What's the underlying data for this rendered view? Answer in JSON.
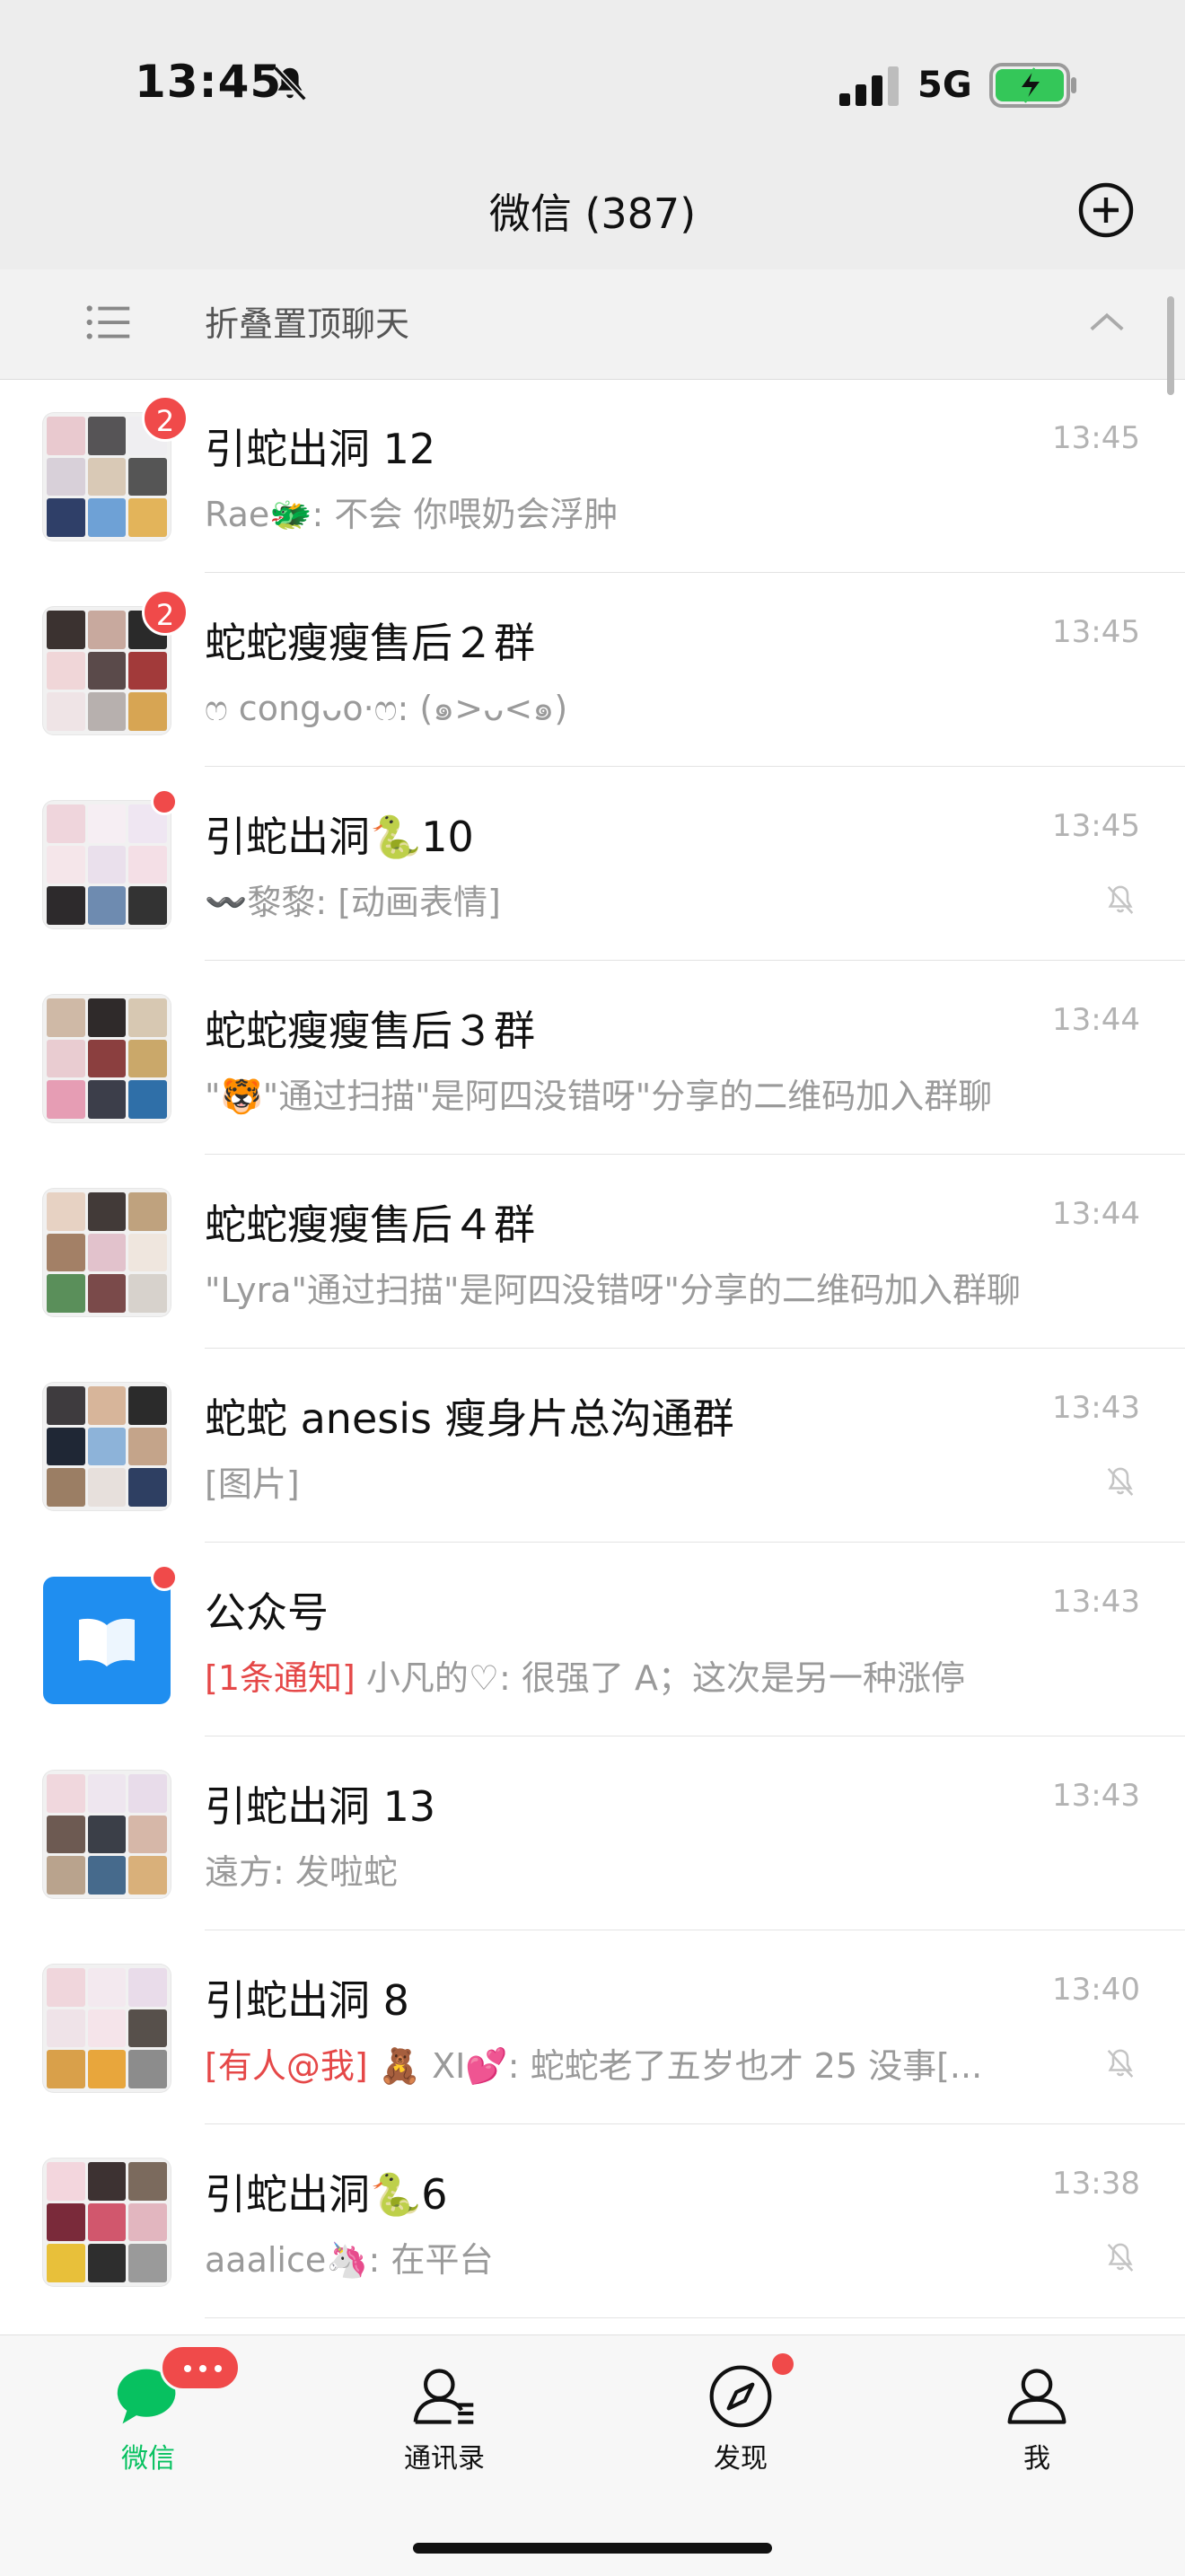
{
  "status_bar": {
    "time": "13:45",
    "network": "5G"
  },
  "header": {
    "title": "微信 (387)"
  },
  "folded_bar": {
    "label": "折叠置顶聊天"
  },
  "chats": [
    {
      "name": "引蛇出洞 12",
      "preview": "Rae🐲: 不会 你喂奶会浮肿",
      "time": "13:45",
      "badge": "2",
      "dot": false,
      "muted": false,
      "tag": "",
      "colors": [
        "#e9c9cf",
        "#565456",
        "#efeef1",
        "#d8d0d9",
        "#d9c9b6",
        "#555",
        "#2f3f68",
        "#6ea1d6",
        "#e3b45a"
      ]
    },
    {
      "name": "蛇蛇瘦瘦售后２群",
      "preview": "ෆ congᴗo·ෆ: (๑>ᴗ<๑)",
      "time": "13:45",
      "badge": "2",
      "dot": false,
      "muted": false,
      "tag": "",
      "colors": [
        "#3b3230",
        "#c8a99e",
        "#2a2a2a",
        "#f0d6d8",
        "#5a4a4a",
        "#a23a3a",
        "#efe4e6",
        "#b7b0ae",
        "#d7a553"
      ]
    },
    {
      "name": "引蛇出洞🐍10",
      "preview": "〰️黎黎: [动画表情]",
      "time": "13:45",
      "badge": "",
      "dot": true,
      "muted": true,
      "tag": "",
      "colors": [
        "#efd5dc",
        "#f6eef3",
        "#efe6f2",
        "#f5e6ea",
        "#eae0ec",
        "#f4dfe6",
        "#2d2a2c",
        "#6e8bb0",
        "#333"
      ]
    },
    {
      "name": "蛇蛇瘦瘦售后３群",
      "preview": "\"🐯\"通过扫描\"是阿四没错呀\"分享的二维码加入群聊",
      "time": "13:44",
      "badge": "",
      "dot": false,
      "muted": false,
      "tag": "",
      "colors": [
        "#cfb9a6",
        "#2f2a2a",
        "#d7c8b2",
        "#e9ccd1",
        "#8b3f3f",
        "#caa86a",
        "#e69db4",
        "#3c3e4a",
        "#2f6fa8"
      ]
    },
    {
      "name": "蛇蛇瘦瘦售后４群",
      "preview": "\"Lyra\"通过扫描\"是阿四没错呀\"分享的二维码加入群聊",
      "time": "13:44",
      "badge": "",
      "dot": false,
      "muted": false,
      "tag": "",
      "colors": [
        "#e7d2c3",
        "#423a38",
        "#bfa27e",
        "#a38066",
        "#e2c2cc",
        "#efe6de",
        "#5a8f5a",
        "#7a4a4a",
        "#d7d2cc"
      ]
    },
    {
      "name": "蛇蛇 anesis 瘦身片总沟通群",
      "preview": "[图片]",
      "time": "13:43",
      "badge": "",
      "dot": false,
      "muted": true,
      "tag": "",
      "colors": [
        "#3e3b3e",
        "#d7b59a",
        "#2b2b2b",
        "#1f2735",
        "#8db3d9",
        "#c4a48a",
        "#9b7e64",
        "#e7e0dc",
        "#2e3f62"
      ]
    },
    {
      "name": "公众号",
      "preview": "小凡的♡: 很强了 A；这次是另一种涨停",
      "time": "13:43",
      "badge": "",
      "dot": true,
      "muted": false,
      "tag": "[1条通知]",
      "official": true,
      "colors": []
    },
    {
      "name": "引蛇出洞 13",
      "preview": "遠方: 发啦蛇",
      "time": "13:43",
      "badge": "",
      "dot": false,
      "muted": false,
      "tag": "",
      "colors": [
        "#f0d7dd",
        "#eee6ef",
        "#e8dcea",
        "#6d5a52",
        "#3b3f48",
        "#d6b7a8",
        "#b9a38d",
        "#466a8c",
        "#d9b07a"
      ]
    },
    {
      "name": "引蛇出洞 8",
      "preview": "🧸 XI💕: 蛇蛇老了五岁也才 25 没事[...",
      "time": "13:40",
      "badge": "",
      "dot": false,
      "muted": true,
      "tag": "[有人@我]",
      "colors": [
        "#f0d6dc",
        "#f3e9ef",
        "#e9dcea",
        "#efe3e8",
        "#f5e4ea",
        "#57504b",
        "#d9a04a",
        "#e8a63c",
        "#8c8c8c"
      ]
    },
    {
      "name": "引蛇出洞🐍6",
      "preview": "aaalice🦄: 在平台",
      "time": "13:38",
      "badge": "",
      "dot": false,
      "muted": true,
      "tag": "",
      "colors": [
        "#f3d6dd",
        "#3d3232",
        "#7b6a5d",
        "#7a2a3a",
        "#d1576d",
        "#e2b6bf",
        "#e8c03a",
        "#2e2e2e",
        "#9a9a9a"
      ]
    }
  ],
  "tabs": [
    {
      "label": "微信",
      "icon": "chat-bubble-icon",
      "active": true
    },
    {
      "label": "通讯录",
      "icon": "contacts-icon",
      "active": false
    },
    {
      "label": "发现",
      "icon": "compass-icon",
      "active": false
    },
    {
      "label": "我",
      "icon": "person-icon",
      "active": false
    }
  ],
  "colors": {
    "accent": "#07c160",
    "badge": "#f04a4a",
    "official_blue": "#1f8ef0"
  }
}
